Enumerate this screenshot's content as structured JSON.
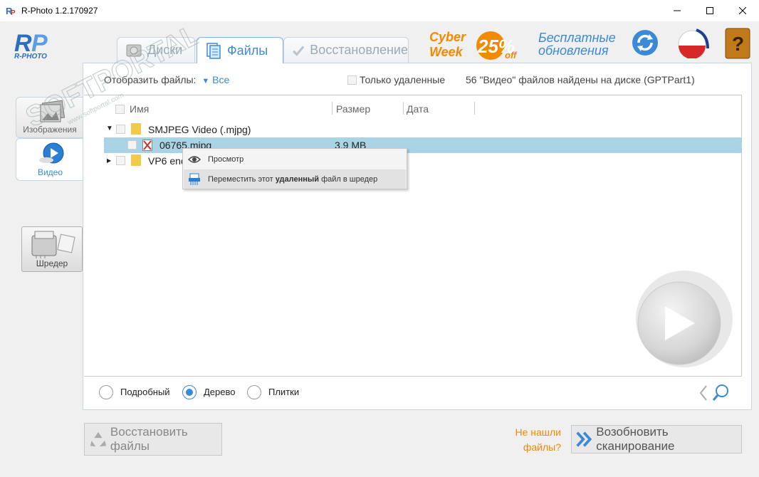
{
  "window": {
    "title": "R-Photo 1.2.170927"
  },
  "header": {
    "logo_text": "R-PHOTO",
    "tabs": [
      {
        "label": "Диски",
        "icon": "disk-icon",
        "active": false
      },
      {
        "label": "Файлы",
        "icon": "files-icon",
        "active": true
      },
      {
        "label": "Восстановление",
        "icon": "recovery-icon",
        "active": false
      }
    ],
    "promo": {
      "line1": "Cyber",
      "line2": "Week",
      "percent": "25%",
      "off": "off"
    },
    "updates_label": "Бесплатные обновления"
  },
  "filter": {
    "label": "Отобразить файлы:",
    "value": "Все",
    "only_deleted": "Только удаленные",
    "found_info": "56 \"Видео\" файлов найдены на диске (GPTPart1)"
  },
  "columns": {
    "name": "Имя",
    "size": "Размер",
    "date": "Дата"
  },
  "tree": {
    "folder1": {
      "name": "SMJPEG Video (.mjpg)"
    },
    "file1": {
      "name": "06765.mjpg",
      "size": "3.9 MB"
    },
    "folder2": {
      "name": "VP6 enc"
    }
  },
  "context_menu": {
    "preview": "Просмотр",
    "shred_prefix": "Переместить этот ",
    "shred_bold": "удаленный",
    "shred_suffix": " файл в шредер"
  },
  "view_modes": {
    "detailed": "Подробный",
    "tree": "Дерево",
    "tiles": "Плитки",
    "selected": "tree"
  },
  "sidebar": {
    "images": "Изображения",
    "video": "Видео",
    "shredder": "Шредер"
  },
  "bottom": {
    "restore": "Восстановить файлы",
    "not_found": "Не нашли файлы?",
    "rescan": "Возобновить сканирование"
  },
  "watermark": {
    "big": "SOFTPORTAL",
    "small": "www.softportal.com"
  },
  "colors": {
    "accent": "#3a8ad8",
    "orange": "#f18a00",
    "selection": "#a8d4e6"
  }
}
